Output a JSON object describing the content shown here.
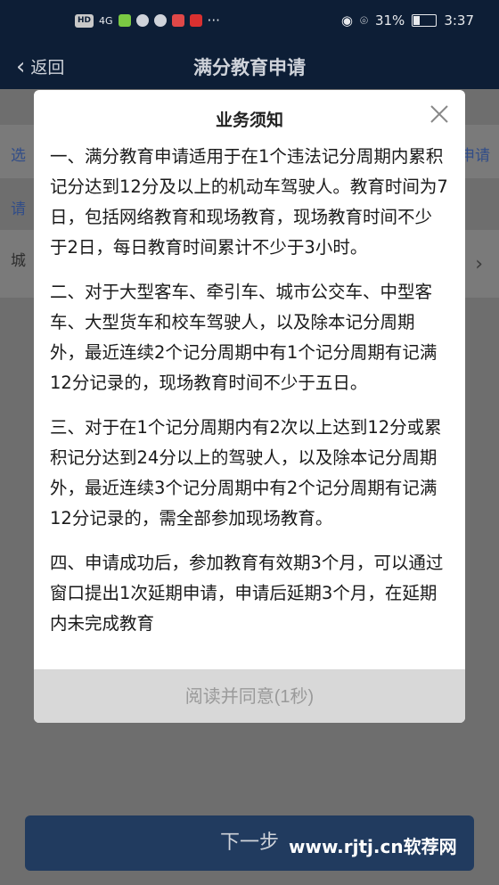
{
  "status_bar": {
    "hd": "HD",
    "signal": "4G",
    "ellipsis": "···",
    "battery_percent": "31%",
    "time": "3:37"
  },
  "header": {
    "back_label": "返回",
    "title": "满分教育申请"
  },
  "background": {
    "row1_left": "选",
    "row1_right": "申请",
    "row2_left": "请",
    "row3_left": "城"
  },
  "modal": {
    "title": "业务须知",
    "paragraphs": [
      "一、满分教育申请适用于在1个违法记分周期内累积记分达到12分及以上的机动车驾驶人。教育时间为7日，包括网络教育和现场教育，现场教育时间不少于2日，每日教育时间累计不少于3小时。",
      "二、对于大型客车、牵引车、城市公交车、中型客车、大型货车和校车驾驶人，以及除本记分周期外，最近连续2个记分周期中有1个记分周期有记满12分记录的，现场教育时间不少于五日。",
      "三、对于在1个记分周期内有2次以上达到12分或累积记分达到24分以上的驾驶人，以及除本记分周期外，最近连续3个记分周期中有2个记分周期有记满12分记录的，需全部参加现场教育。",
      "四、申请成功后，参加教育有效期3个月，可以通过窗口提出1次延期申请，申请后延期3个月，在延期内未完成教育"
    ],
    "agree_label": "阅读并同意(1秒)"
  },
  "footer": {
    "next_label": "下一步",
    "watermark": "www.rjtj.cn软荐网"
  }
}
